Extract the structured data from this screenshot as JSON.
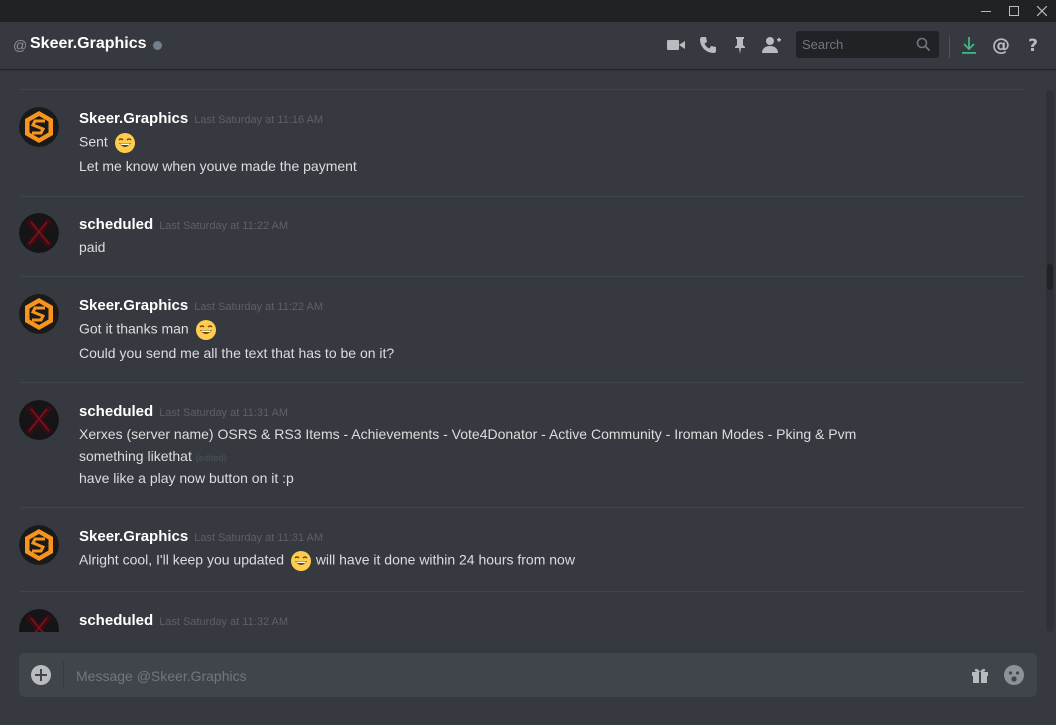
{
  "window": {
    "controls": [
      "minimize",
      "maximize",
      "close"
    ]
  },
  "header": {
    "at_symbol": "@",
    "title": "Skeer.Graphics",
    "status": "offline",
    "icons": [
      "video-camera-icon",
      "phone-icon",
      "pin-icon",
      "add-friend-icon",
      "search-icon",
      "download-icon",
      "mention-icon",
      "help-icon"
    ],
    "search_placeholder": "Search",
    "help_glyph": "?"
  },
  "messages": [
    {
      "author": "Skeer.Graphics",
      "timestamp": "Last Saturday at 11:16 AM",
      "lines": [
        {
          "text": "Sent",
          "emoji": "grinning-face-emoji"
        },
        {
          "text": "Let me know when youve made the payment"
        }
      ]
    },
    {
      "author": "scheduled",
      "timestamp": "Last Saturday at 11:22 AM",
      "lines": [
        {
          "text": "paid"
        }
      ]
    },
    {
      "author": "Skeer.Graphics",
      "timestamp": "Last Saturday at 11:22 AM",
      "lines": [
        {
          "text": "Got it thanks man",
          "emoji": "grinning-face-emoji"
        },
        {
          "text": "Could you send me all the text that has to be on it?"
        }
      ]
    },
    {
      "author": "scheduled",
      "timestamp": "Last Saturday at 11:31 AM",
      "lines": [
        {
          "text": "Xerxes (server name)  OSRS & RS3 Items - Achievements - Vote4Donator - Active Community - Iroman Modes - Pking & Pvm"
        },
        {
          "text": "something likethat",
          "edited": "(edited)"
        },
        {
          "text": "have like a play now button on it :p"
        }
      ]
    },
    {
      "author": "Skeer.Graphics",
      "timestamp": "Last Saturday at 11:31 AM",
      "lines": [
        {
          "text": "Alright cool, I'll keep you updated",
          "emoji": "grinning-face-emoji",
          "text_after": "will have it done within 24 hours from now"
        }
      ]
    },
    {
      "author": "scheduled",
      "timestamp": "Last Saturday at 11:32 AM",
      "lines": []
    }
  ],
  "composer": {
    "placeholder": "Message @Skeer.Graphics",
    "icons": [
      "add-attachment-icon",
      "gift-icon",
      "emoji-picker-icon"
    ]
  },
  "colors": {
    "background": "#36393f",
    "titlebar": "#202225",
    "composer": "#40444b",
    "username": "#ffffff",
    "timestamp": "#5d6066",
    "text": "#dcddde",
    "download_accent": "#43b581",
    "avatar_orange": "#f7941d"
  }
}
